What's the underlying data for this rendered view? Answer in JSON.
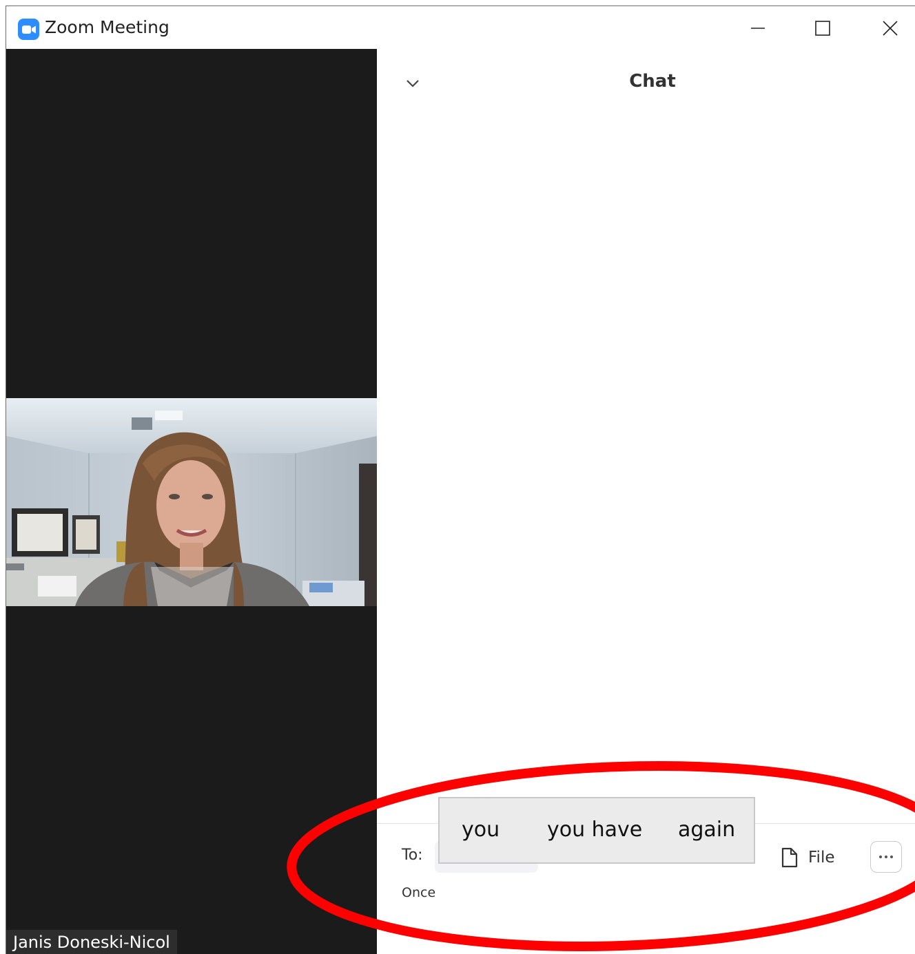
{
  "window": {
    "title": "Zoom Meeting",
    "icon": "zoom-camera-icon",
    "controls": [
      "minimize-icon",
      "maximize-icon",
      "close-icon"
    ]
  },
  "video": {
    "participant_name": "Janis Doneski-Nicol"
  },
  "chat": {
    "title": "Chat",
    "collapse_icon": "chevron-down-icon",
    "to_label": "To:",
    "file_label": "File",
    "file_icon": "file-icon",
    "more_icon": "more-options-icon",
    "input_value": "Once"
  },
  "autocomplete": {
    "suggestions": [
      "you",
      "you have",
      "again"
    ]
  },
  "annotation": {
    "color": "#ff0000"
  }
}
